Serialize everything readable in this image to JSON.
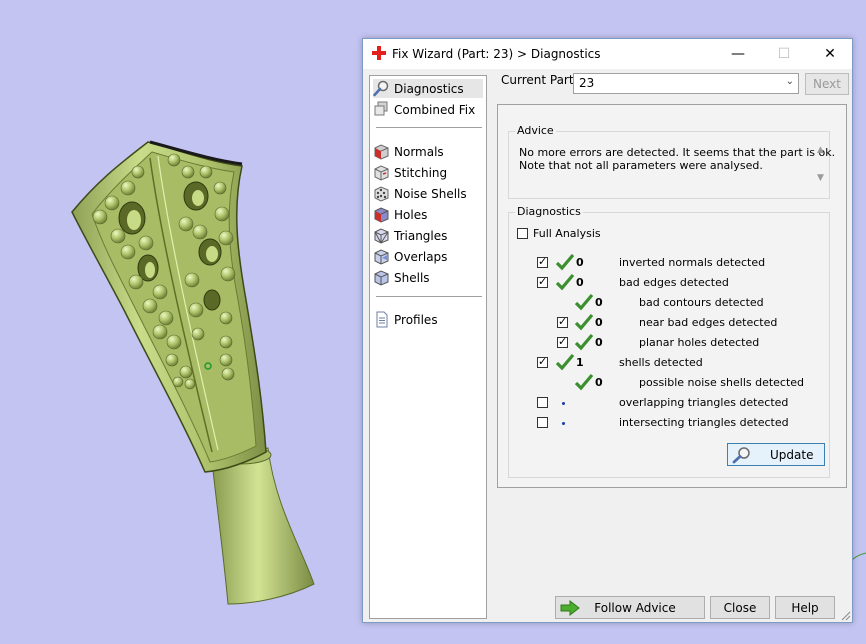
{
  "window": {
    "title": "Fix Wizard (Part: 23) > Diagnostics",
    "minimize_glyph": "—",
    "maximize_glyph": "☐",
    "close_glyph": "✕",
    "icon": "red-cross-icon"
  },
  "nav": {
    "items": [
      {
        "label": "Diagnostics",
        "icon": "magnifier-icon",
        "selected": true
      },
      {
        "label": "Combined Fix",
        "icon": "cubes-icon"
      },
      {
        "label": "Normals",
        "icon": "normals-cube-icon"
      },
      {
        "label": "Stitching",
        "icon": "stitch-cube-icon"
      },
      {
        "label": "Noise Shells",
        "icon": "dots-cube-icon"
      },
      {
        "label": "Holes",
        "icon": "holes-cube-icon"
      },
      {
        "label": "Triangles",
        "icon": "triangles-cube-icon"
      },
      {
        "label": "Overlaps",
        "icon": "overlaps-cube-icon"
      },
      {
        "label": "Shells",
        "icon": "shells-cube-icon"
      },
      {
        "label": "Profiles",
        "icon": "document-icon"
      }
    ]
  },
  "current_part": {
    "label": "Current Part:",
    "value": "23",
    "next_label": "Next"
  },
  "advice": {
    "legend": "Advice",
    "line1": "No more errors are detected. It seems that the part is ok.",
    "line2": "Note that not all parameters were analysed."
  },
  "diagnostics": {
    "legend": "Diagnostics",
    "full_analysis_label": "Full Analysis",
    "full_analysis_checked": false,
    "rows": [
      {
        "checked": true,
        "status": "ok",
        "count": "0",
        "label": "inverted normals detected",
        "indent": 0
      },
      {
        "checked": true,
        "status": "ok",
        "count": "0",
        "label": "bad edges detected",
        "indent": 0
      },
      {
        "checked": null,
        "status": "ok",
        "count": "0",
        "label": "bad contours detected",
        "indent": 1
      },
      {
        "checked": true,
        "status": "ok",
        "count": "0",
        "label": "near bad edges detected",
        "indent": 1
      },
      {
        "checked": true,
        "status": "ok",
        "count": "0",
        "label": "planar holes detected",
        "indent": 1
      },
      {
        "checked": true,
        "status": "ok",
        "count": "1",
        "label": "shells detected",
        "indent": 0
      },
      {
        "checked": null,
        "status": "ok",
        "count": "0",
        "label": "possible noise shells detected",
        "indent": 1
      },
      {
        "checked": false,
        "status": "none",
        "count": "",
        "label": "overlapping triangles detected",
        "indent": 0
      },
      {
        "checked": false,
        "status": "none",
        "count": "",
        "label": "intersecting triangles detected",
        "indent": 0
      }
    ],
    "update_label": "Update"
  },
  "footer": {
    "follow_advice_label": "Follow Advice",
    "close_label": "Close",
    "help_label": "Help"
  },
  "colors": {
    "background": "#c4c4f2",
    "model": "#b9cf7a",
    "accent_green": "#3b8f2e",
    "dialog_border": "#7a9cc6"
  }
}
